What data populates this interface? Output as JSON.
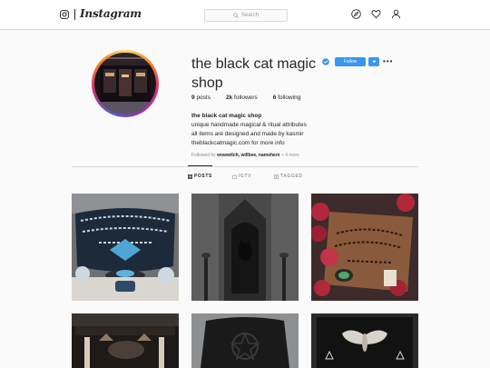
{
  "nav": {
    "wordmark": "Instagram",
    "search_placeholder": "Search"
  },
  "profile": {
    "username": "the black cat magic shop",
    "follow_label": "Follow",
    "stats": {
      "posts_count": "9",
      "posts_label": "posts",
      "followers_count": "2k",
      "followers_label": "followers",
      "following_count": "6",
      "following_label": "following"
    },
    "bio": {
      "name": "the black cat magic shop",
      "line1": "unique handmade magical & ritual attributes",
      "line2": "all items are designed and made by kasmir",
      "line3": "theblackcatmagic.com for more info"
    },
    "followed_by": {
      "prefix": "Followed by",
      "users": "wowwitch, willbee, namehere",
      "more": "+ 4 more"
    }
  },
  "tabs": [
    {
      "label": "POSTS",
      "active": true
    },
    {
      "label": "IGTV",
      "active": false
    },
    {
      "label": "TAGGED",
      "active": false
    }
  ],
  "colors": {
    "accent": "#3897f0",
    "text": "#262626",
    "muted": "#8e8e8e",
    "border": "#dbdbdb",
    "background": "#fafafa"
  },
  "icons": [
    "instagram-glyph-icon",
    "search-icon",
    "explore-compass-icon",
    "heart-icon",
    "profile-icon",
    "verified-badge-icon",
    "dropdown-caret-icon",
    "grid-icon",
    "igtv-icon",
    "tag-icon"
  ]
}
